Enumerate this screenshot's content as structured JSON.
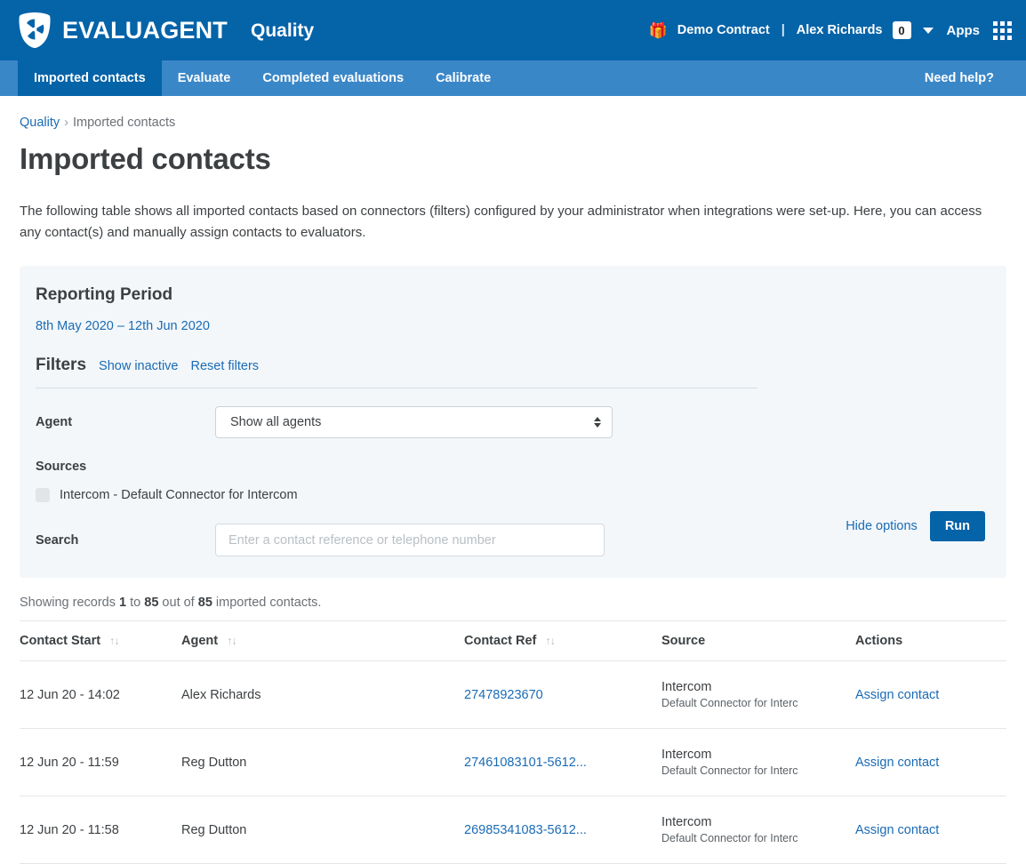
{
  "brand": {
    "logo_icon": "evaluagent-shield-logo",
    "name": "EVALUAGENT",
    "product": "Quality"
  },
  "topbar": {
    "gift_icon": "gift-icon",
    "contract": "Demo Contract",
    "separator": "|",
    "user": "Alex Richards",
    "badge_count": "0",
    "caret_icon": "chevron-down-icon",
    "apps_label": "Apps",
    "apps_icon": "apps-grid-icon"
  },
  "nav": {
    "items": [
      {
        "label": "Imported contacts",
        "active": true
      },
      {
        "label": "Evaluate",
        "active": false
      },
      {
        "label": "Completed evaluations",
        "active": false
      },
      {
        "label": "Calibrate",
        "active": false
      }
    ],
    "help_label": "Need help?"
  },
  "breadcrumb": {
    "root": "Quality",
    "separator": "›",
    "current": "Imported contacts"
  },
  "page": {
    "title": "Imported contacts",
    "description": "The following table shows all imported contacts based on connectors (filters) configured by your administrator when integrations were set-up. Here, you can access any contact(s) and manually assign contacts to evaluators."
  },
  "filter_card": {
    "reporting_period_title": "Reporting Period",
    "reporting_period_value": "8th May 2020 – 12th Jun 2020",
    "filters_title": "Filters",
    "show_inactive_label": "Show inactive",
    "reset_filters_label": "Reset filters",
    "agent_label": "Agent",
    "agent_value": "Show all agents",
    "sources_label": "Sources",
    "sources": [
      {
        "label": "Intercom - Default Connector for Intercom",
        "checked": false
      }
    ],
    "search_label": "Search",
    "search_value": "",
    "search_placeholder": "Enter a contact reference or telephone number",
    "hide_options_label": "Hide options",
    "run_label": "Run"
  },
  "records_summary": {
    "prefix": "Showing records ",
    "from": "1",
    "mid1": " to ",
    "to": "85",
    "mid2": " out of ",
    "total": "85",
    "suffix": " imported contacts."
  },
  "table": {
    "columns": [
      {
        "label": "Contact Start",
        "sortable": true
      },
      {
        "label": "Agent",
        "sortable": true
      },
      {
        "label": "Contact Ref",
        "sortable": true
      },
      {
        "label": "Source",
        "sortable": false
      },
      {
        "label": "Actions",
        "sortable": false
      }
    ],
    "sort_icon": "↑↓",
    "rows": [
      {
        "contact_start": "12 Jun 20 - 14:02",
        "agent": "Alex Richards",
        "contact_ref": "27478923670",
        "source_name": "Intercom",
        "source_sub": "Default Connector for Interc",
        "action": "Assign contact"
      },
      {
        "contact_start": "12 Jun 20 - 11:59",
        "agent": "Reg Dutton",
        "contact_ref": "27461083101-5612...",
        "source_name": "Intercom",
        "source_sub": "Default Connector for Interc",
        "action": "Assign contact"
      },
      {
        "contact_start": "12 Jun 20 - 11:58",
        "agent": "Reg Dutton",
        "contact_ref": "26985341083-5612...",
        "source_name": "Intercom",
        "source_sub": "Default Connector for Interc",
        "action": "Assign contact"
      }
    ]
  },
  "colors": {
    "brand_blue": "#0563a8",
    "nav_blue": "#3a87c8",
    "link_blue": "#1a6bb5",
    "card_bg": "#f3f7fa",
    "text": "#3c4043"
  }
}
